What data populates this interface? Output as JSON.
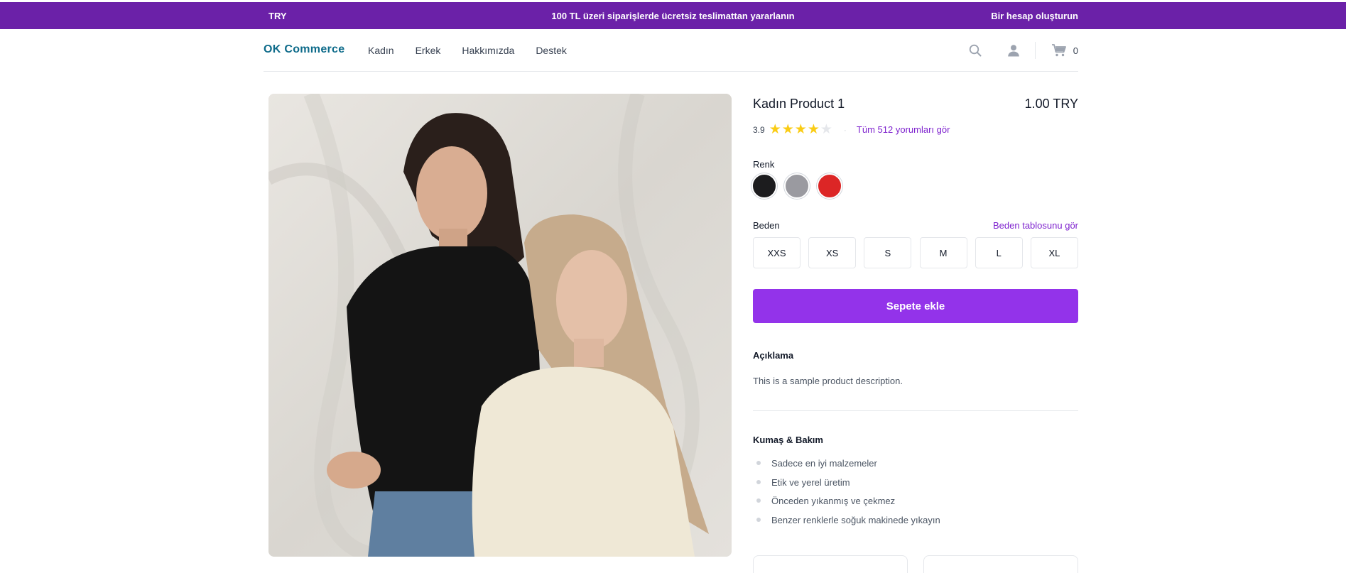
{
  "promo": {
    "currency": "TRY",
    "message": "100 TL üzeri siparişlerde ücretsiz teslimattan yararlanın",
    "account_link": "Bir hesap oluşturun"
  },
  "header": {
    "logo": "OK Commerce",
    "nav": [
      "Kadın",
      "Erkek",
      "Hakkımızda",
      "Destek"
    ],
    "cart_count": "0"
  },
  "product": {
    "title": "Kadın Product 1",
    "price": "1.00 TRY",
    "rating": "3.9",
    "rating_value": 3.9,
    "rating_max": 5,
    "reviews_link": "Tüm 512 yorumları gör",
    "color_label": "Renk",
    "colors": [
      "#1c1c1e",
      "#9a9aa0",
      "#dc2626"
    ],
    "size_label": "Beden",
    "size_guide_link": "Beden tablosunu gör",
    "sizes": [
      "XXS",
      "XS",
      "S",
      "M",
      "L",
      "XL"
    ],
    "add_to_cart": "Sepete ekle",
    "description_heading": "Açıklama",
    "description": "This is a sample product description.",
    "care_heading": "Kumaş & Bakım",
    "care_items": [
      "Sadece en iyi malzemeler",
      "Etik ve yerel üretim",
      "Önceden yıkanmış ve çekmez",
      "Benzer renklerle soğuk makinede yıkayın"
    ]
  },
  "colors": {
    "brand_purple": "#6b21a8",
    "button_purple": "#9333ea",
    "link_purple": "#7e22ce",
    "logo_teal": "#0e6b8a",
    "star_gold": "#facc15"
  }
}
